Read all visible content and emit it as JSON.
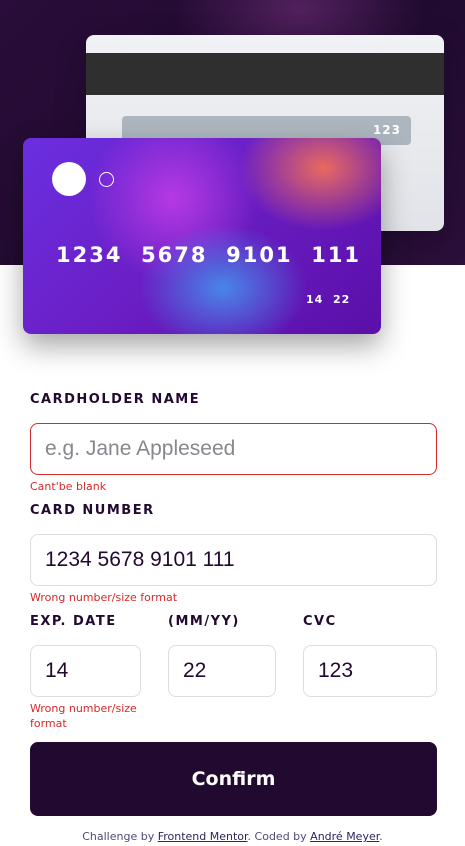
{
  "cards": {
    "back": {
      "cvc": "123"
    },
    "front": {
      "number": "1234  5678  9101  111",
      "exp_month": "14",
      "exp_year": "22"
    }
  },
  "form": {
    "cardholder": {
      "label": "CARDHOLDER NAME",
      "placeholder": "e.g. Jane Appleseed",
      "value": "",
      "error": "Cant'be blank"
    },
    "card_number": {
      "label": "CARD NUMBER",
      "value": "1234 5678 9101 111",
      "error": "Wrong number/size format"
    },
    "exp_date": {
      "label": "EXP. DATE",
      "label_suffix": "(MM/YY)",
      "month": "14",
      "year": "22",
      "error": "Wrong number/size format"
    },
    "cvc": {
      "label": "CVC",
      "value": "123"
    },
    "confirm_label": "Confirm"
  },
  "footer": {
    "prefix": "Challenge by ",
    "link1": "Frontend Mentor",
    "middle": ". Coded by ",
    "link2": "André Meyer",
    "suffix": "."
  },
  "colors": {
    "dark_violet": "#21092f",
    "error_red": "#d52a2a",
    "border": "#dedddf"
  }
}
